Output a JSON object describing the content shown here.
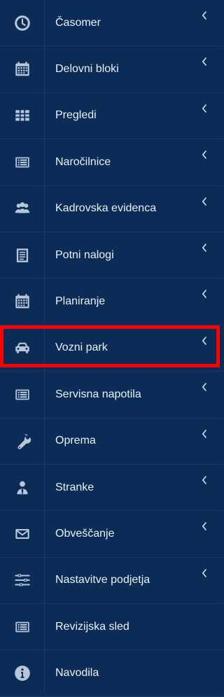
{
  "sidebar": {
    "items": [
      {
        "label": "Časomer"
      },
      {
        "label": "Delovni bloki"
      },
      {
        "label": "Pregledi"
      },
      {
        "label": "Naročilnice"
      },
      {
        "label": "Kadrovska evidenca"
      },
      {
        "label": "Potni nalogi"
      },
      {
        "label": "Planiranje"
      },
      {
        "label": "Vozni park"
      },
      {
        "label": "Servisna napotila"
      },
      {
        "label": "Oprema"
      },
      {
        "label": "Stranke"
      },
      {
        "label": "Obveščanje"
      },
      {
        "label": "Nastavitve podjetja"
      },
      {
        "label": "Revizijska sled"
      },
      {
        "label": "Navodila"
      }
    ]
  },
  "colors": {
    "background": "#0b2c56",
    "divider": "#173a68",
    "icon": "#b7c6db",
    "text": "#eaf1fb",
    "highlight": "#ff0000"
  },
  "icons": [
    "clock-icon",
    "calendar-icon",
    "table-icon",
    "list-card-icon",
    "users-icon",
    "document-icon",
    "calendar-icon",
    "car-icon",
    "list-card-icon",
    "wrench-icon",
    "user-tie-icon",
    "envelope-icon",
    "sliders-icon",
    "list-card-icon",
    "info-icon"
  ]
}
